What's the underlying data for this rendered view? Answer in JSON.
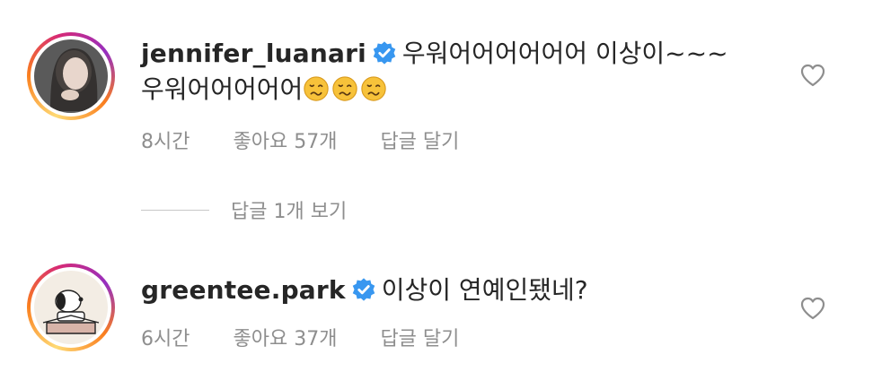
{
  "comments": [
    {
      "username": "jennifer_luanari",
      "text_line1": "우워어어어어어어 이상이~~~",
      "text_line2": "우워어어어어어",
      "time": "8시간",
      "likes": "좋아요 57개",
      "reply": "답글 달기",
      "emoji": "woozy-face-icon"
    },
    {
      "username": "greentee.park",
      "text_line1": "이상이 연예인됐네?",
      "time": "6시간",
      "likes": "좋아요 37개",
      "reply": "답글 달기"
    }
  ],
  "view_replies": "답글 1개 보기",
  "colors": {
    "text": "#262626",
    "meta": "#8e8e8e",
    "verified": "#3897f0"
  }
}
